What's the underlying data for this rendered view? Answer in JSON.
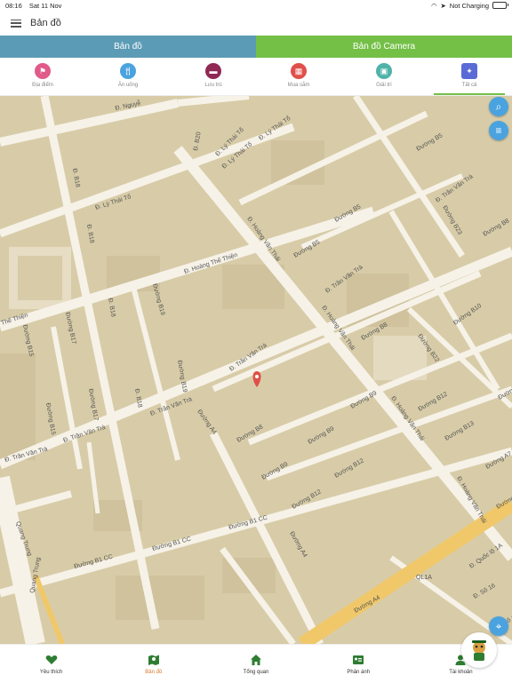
{
  "status_bar": {
    "time": "08:16",
    "date": "Sat 11 Nov",
    "charging": "Not Charging"
  },
  "header": {
    "title": "Bản đồ"
  },
  "top_tabs": [
    {
      "label": "Bản đồ",
      "color": "#5b9bb5"
    },
    {
      "label": "Bản đồ Camera",
      "color": "#74c047"
    }
  ],
  "categories": [
    {
      "label": "Địa điểm",
      "icon": "flag-icon",
      "color": "#e05a8a"
    },
    {
      "label": "Ăn uống",
      "icon": "fork-knife-icon",
      "color": "#4aa3df"
    },
    {
      "label": "Lưu trú",
      "icon": "bed-icon",
      "color": "#8e2a54"
    },
    {
      "label": "Mua sắm",
      "icon": "shop-icon",
      "color": "#e0504a"
    },
    {
      "label": "Giải trí",
      "icon": "ticket-icon",
      "color": "#4fb3a9"
    },
    {
      "label": "Tất cả",
      "icon": "all-categories-icon",
      "color": "#5b6bd6"
    }
  ],
  "map": {
    "streets": [
      "Đ. Nguyễ",
      "Đ. B20",
      "Đ. Lý Thái Tổ",
      "Đ. Lý Thái Tổ",
      "Đ. Lý Thái Tổ",
      "Đ. B18",
      "Đ. Lý Thái Tổ",
      "Đ. B18",
      "Đường B5",
      "Đường B5",
      "Đ. Trần Văn Trà",
      "Đường B23",
      "Đường B8",
      "Đường B5",
      "Đ. Hoàng Văn Thái",
      "Đ. Hoàng Thế Thiện",
      "Thế Thiện",
      "Đường B19",
      "Đ. B18",
      "Đường B17",
      "Đường B15",
      "Đ. Trần Văn Trà",
      "Đ. Hoàng Văn Thái",
      "Đường B10",
      "Đường B8",
      "Đường B22",
      "Đ. Trần Văn Trà",
      "Đường B19",
      "Đ. B18",
      "Đường B17",
      "Đường B15",
      "Đ. Trần Văn Trà",
      "Đ. Trần Văn Trà",
      "Đ. Trần Văn Trà",
      "Đường A4",
      "Đường B8",
      "Đường B9",
      "Đường B9",
      "Đ. Hoàng Văn Thái",
      "Đường B12",
      "Đường B13",
      "Đường B13",
      "Đường B9",
      "Đường B12",
      "Đường B12",
      "Đường A7",
      "Đ. Hoàng Văn Thái",
      "Đường B1 CC",
      "Đường B1 CC",
      "Đường B1 CC",
      "Đường A4",
      "Quang Trung",
      "Quang Trung",
      "Đ. Quốc lộ 1A",
      "QL1A",
      "Đường A4",
      "Đường B1",
      "Đ. Số 16",
      "Đ. Số 16"
    ]
  },
  "bottom_nav": [
    {
      "label": "Yêu thích",
      "icon": "heart-icon"
    },
    {
      "label": "Bản đồ",
      "icon": "map-icon"
    },
    {
      "label": "Tổng quan",
      "icon": "home-icon"
    },
    {
      "label": "Phản ánh",
      "icon": "report-icon"
    },
    {
      "label": "Tài khoản",
      "icon": "account-icon"
    }
  ]
}
